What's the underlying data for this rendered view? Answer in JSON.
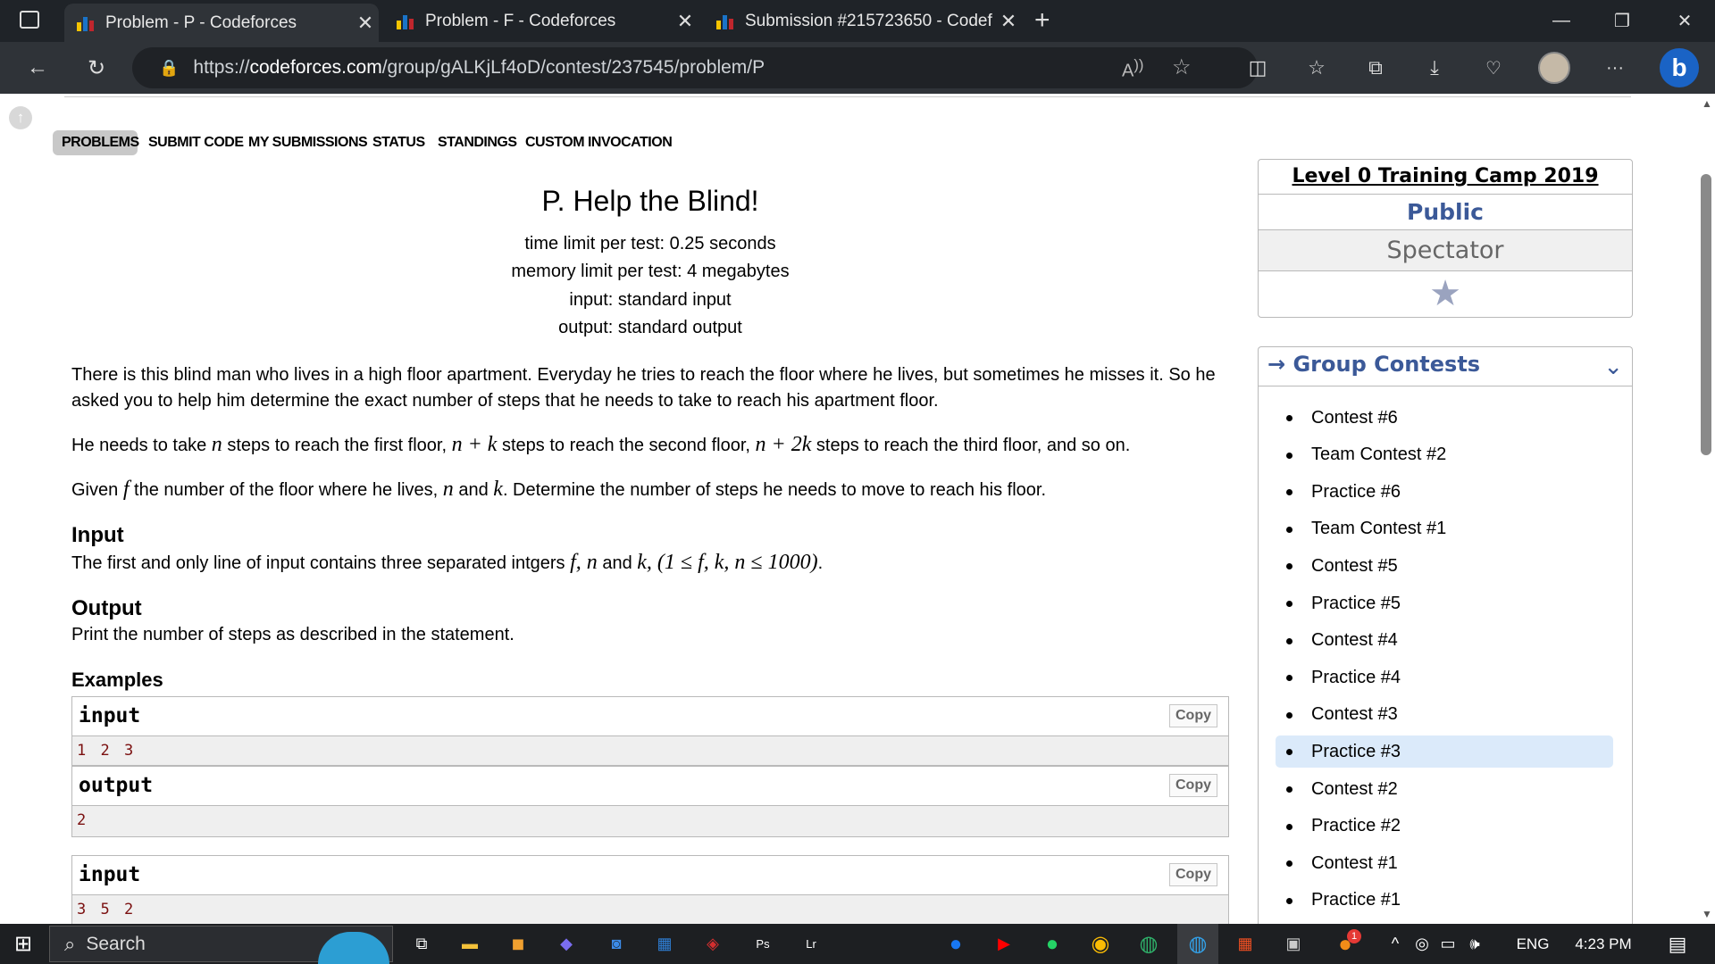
{
  "tabs": [
    {
      "title": "Problem - P - Codeforces",
      "active": true
    },
    {
      "title": "Problem - F - Codeforces",
      "active": false
    },
    {
      "title": "Submission #215723650 - Codef",
      "active": false
    }
  ],
  "address": {
    "prefix": "https://",
    "host": "codeforces.com",
    "path": "/group/gALKjLf4oD/contest/237545/problem/P"
  },
  "menu": [
    {
      "label": "PROBLEMS",
      "selected": true
    },
    {
      "label": "SUBMIT CODE",
      "selected": false
    },
    {
      "label": "MY SUBMISSIONS",
      "selected": false
    },
    {
      "label": "STATUS",
      "selected": false
    },
    {
      "label": "STANDINGS",
      "selected": false
    },
    {
      "label": "CUSTOM INVOCATION",
      "selected": false
    }
  ],
  "problem": {
    "title": "P. Help the Blind!",
    "time_limit": "time limit per test: 0.25 seconds",
    "memory_limit": "memory limit per test: 4 megabytes",
    "input_src": "input: standard input",
    "output_src": "output: standard output",
    "para1": "There is this blind man who lives in a high floor apartment. Everyday he tries to reach the floor where he lives, but sometimes he misses it. So he asked you to help him determine the exact number of steps that he needs to take to reach his apartment floor.",
    "para2": {
      "a": "He needs to take ",
      "m1": "n",
      "b": " steps to reach the first floor, ",
      "m2": "n + k",
      "c": " steps to reach the second floor, ",
      "m3": "n + 2k",
      "d": " steps to reach the third floor, and so on."
    },
    "para3": {
      "a": "Given ",
      "m1": "f",
      "b": " the number of the floor where he lives, ",
      "m2": "n",
      "c": " and ",
      "m3": "k",
      "d": ". Determine the number of steps he needs to move to reach his floor."
    },
    "input_title": "Input",
    "input_text": {
      "a": "The first and only line of input contains three separated intgers ",
      "m1": "f, n",
      "b": " and ",
      "m2": "k, (1 ≤ f, k, n ≤ 1000)",
      "c": "."
    },
    "output_title": "Output",
    "output_text": "Print the number of steps as described in the statement.",
    "examples_title": "Examples",
    "copy_label": "Copy",
    "samples": [
      {
        "label": "input",
        "value": "1 2 3"
      },
      {
        "label": "output",
        "value": "2"
      },
      {
        "label": "input",
        "value": "3 5 2"
      }
    ]
  },
  "sidebar": {
    "contest_name": "Level 0 Training Camp 2019",
    "visibility": "Public",
    "role": "Spectator",
    "group_title": "→ Group Contests",
    "contests": [
      "Contest #6",
      "Team Contest #2",
      "Practice #6",
      "Team Contest #1",
      "Contest #5",
      "Practice #5",
      "Contest #4",
      "Practice #4",
      "Contest #3",
      "Practice #3",
      "Contest #2",
      "Practice #2",
      "Contest #1",
      "Practice #1"
    ],
    "selected": "Practice #3"
  },
  "taskbar": {
    "search": "Search",
    "lang": "ENG",
    "time": "4:23 PM",
    "notif_count": "1"
  },
  "colors": {
    "accent": "#3b5998",
    "selected_bg": "#dbeafa",
    "sample_value": "#7b1010"
  }
}
